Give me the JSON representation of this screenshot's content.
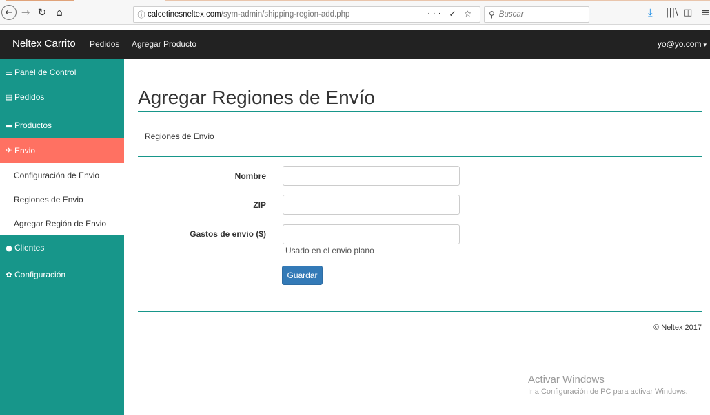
{
  "browser": {
    "url_domain": "calcetinesneltex.com",
    "url_path": "/sym-admin/shipping-region-add.php",
    "url_actions": "··· ✓ ☆",
    "search_placeholder": "Buscar",
    "icons": [
      "back-icon",
      "forward-icon",
      "reload-icon",
      "home-icon",
      "info-icon",
      "more-icon",
      "pocket-icon",
      "bookmark-star-icon",
      "search-icon",
      "download-icon",
      "library-icon",
      "sidebar-icon",
      "menu-icon"
    ]
  },
  "navbar": {
    "brand": "Neltex Carrito",
    "links": [
      "Pedidos",
      "Agregar Producto"
    ],
    "user": "yo@yo.com"
  },
  "sidebar": {
    "items": [
      {
        "label": "Panel de Control",
        "icon": "dashboard-icon"
      },
      {
        "label": "Pedidos",
        "icon": "list-icon"
      },
      {
        "label": "Productos",
        "icon": "briefcase-icon"
      },
      {
        "label": "Envio",
        "icon": "plane-icon",
        "active": true
      },
      {
        "label": "Clientes",
        "icon": "user-icon"
      },
      {
        "label": "Configuración",
        "icon": "gear-icon"
      }
    ],
    "subitems": [
      "Configuración de Envio",
      "Regiones de Envio",
      "Agregar Región de Envio"
    ],
    "colors": {
      "background": "#17968a",
      "active": "#ff7162"
    }
  },
  "main": {
    "title": "Agregar Regiones de Envío",
    "section": "Regiones de Envio",
    "form": {
      "fields": [
        {
          "label": "Nombre",
          "value": ""
        },
        {
          "label": "ZIP",
          "value": ""
        },
        {
          "label": "Gastos de envio ($)",
          "value": ""
        }
      ],
      "help": "Usado en el envio plano",
      "submit": "Guardar"
    },
    "footer": "© Neltex 2017"
  },
  "watermark": {
    "title": "Activar Windows",
    "subtitle": "Ir a Configuración de PC para activar Windows."
  },
  "colors": {
    "accent": "#17968a",
    "button": "#337ab7",
    "navbar": "#222222"
  }
}
